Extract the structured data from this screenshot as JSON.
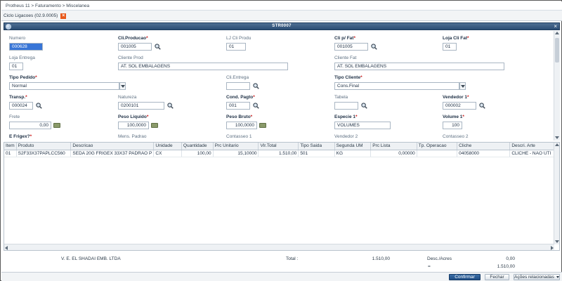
{
  "breadcrumb": "Protheus 11 > Faturamento > Miscelanea",
  "doc_tab": {
    "label": "Ciclo Ligacoes (02.9.0005)"
  },
  "window": {
    "title": "STR0007"
  },
  "form": {
    "numero": {
      "label": "Numero",
      "value": "000628"
    },
    "cli_producao": {
      "label": "Cli.Producao",
      "value": "001005"
    },
    "lj_cli_produ": {
      "label": "LJ Cli Produ",
      "value": "01"
    },
    "cli_fat": {
      "label": "Cli p/ Fat",
      "value": "001005"
    },
    "loja_cli_fat": {
      "label": "Loja Cli Fat",
      "value": "01"
    },
    "loja_entrega": {
      "label": "Loja Entrega",
      "value": "01"
    },
    "cliente_prod": {
      "label": "Cliente Prod",
      "value": "AT. SOL EMBALAGENS"
    },
    "cliente_fat": {
      "label": "Cliente Fat",
      "value": "AT. SOL EMBALAGENS"
    },
    "tipo_pedido": {
      "label": "Tipo Pedido",
      "value": "Normal"
    },
    "cli_entrega": {
      "label": "Cli.Entrega",
      "value": ""
    },
    "tipo_cliente": {
      "label": "Tipo Cliente",
      "value": "Cons.Final"
    },
    "transp": {
      "label": "Transp.",
      "value": "000024"
    },
    "natureza": {
      "label": "Natureza",
      "value": "0200101"
    },
    "cond_pagto": {
      "label": "Cond. Pagto",
      "value": "001"
    },
    "tabela": {
      "label": "Tabela",
      "value": ""
    },
    "vendedor_1": {
      "label": "Vendedor 1",
      "value": "000002"
    },
    "frete": {
      "label": "Frete",
      "value": "0,00"
    },
    "peso_liquido": {
      "label": "Peso Liquido",
      "value": "100,0000"
    },
    "peso_bruto": {
      "label": "Peso Bruto",
      "value": "100,0000"
    },
    "especie_1": {
      "label": "Especie 1",
      "value": "VOLUMES"
    },
    "volume_1": {
      "label": "Volume 1",
      "value": "100"
    },
    "e_frigex": {
      "label": "E Frigex?"
    },
    "mens_padrao": {
      "label": "Mens. Padrao"
    },
    "contasseo_1": {
      "label": "Contasseo 1"
    },
    "vendedor_2": {
      "label": "Vendedor 2"
    },
    "contasseo_2": {
      "label": "Contasseo 2"
    }
  },
  "grid": {
    "columns": [
      "Item",
      "Produto",
      "Descricao",
      "Unidade",
      "Quantidade",
      "Prc Unitario",
      "Vlr.Total",
      "Tipo Saida",
      "Segunda UM",
      "Prc Lista",
      "Tp. Operacao",
      "Cliche",
      "Descri. Arte"
    ],
    "rows": [
      [
        "01",
        "S2F33X37PAPLCC560",
        "SEDA 20G FRIGEX 33X37 PADRAO P",
        "CX",
        "100,00",
        "15,10000",
        "1.510,00",
        "501",
        "KG",
        "0,00000",
        "",
        "04058000",
        "CLICHE - NAO UTI"
      ]
    ]
  },
  "summary": {
    "client_name": "V. E. EL SHADAI EMB. LTDA",
    "total_label": "Total :",
    "total_value": "1.510,00",
    "desc_label": "Desc./Acres",
    "desc_value": "0,00",
    "equals_sign": "=",
    "final_value": "1.510,00"
  },
  "footer": {
    "confirm_label": "Confirmar",
    "close_label": "Fechar",
    "actions_label": "Ações relacionadas"
  },
  "colors": {
    "title_bar": "#2b4d74",
    "primary_button": "#1f4d84",
    "tab_close": "#e8591c",
    "required_star": "#c81414",
    "selection": "#3875d7"
  }
}
